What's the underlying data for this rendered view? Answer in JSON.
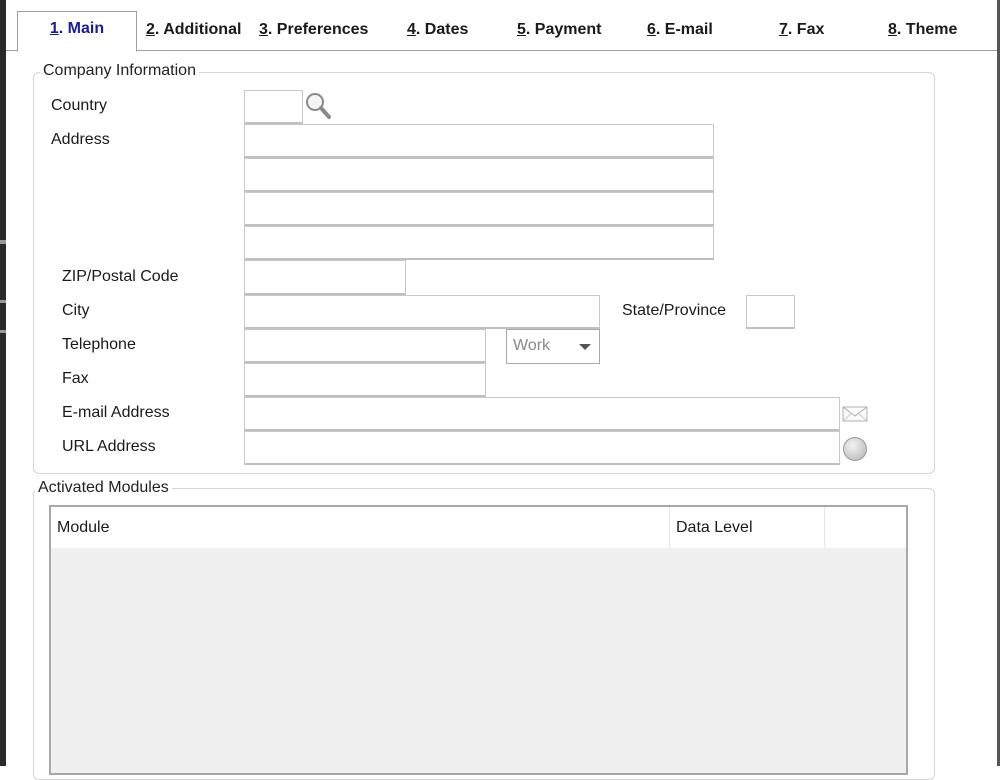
{
  "tabs": [
    {
      "num": "1",
      "label": ". Main",
      "active": true
    },
    {
      "num": "2",
      "label": ". Additional"
    },
    {
      "num": "3",
      "label": ". Preferences"
    },
    {
      "num": "4",
      "label": ". Dates"
    },
    {
      "num": "5",
      "label": ". Payment"
    },
    {
      "num": "6",
      "label": ". E-mail"
    },
    {
      "num": "7",
      "label": ". Fax"
    },
    {
      "num": "8",
      "label": ". Theme"
    }
  ],
  "company_info": {
    "title": "Company Information",
    "country_label": "Country",
    "country_value": "",
    "address_label": "Address",
    "address_lines": [
      "",
      "",
      "",
      ""
    ],
    "zip_label": "ZIP/Postal Code",
    "zip_value": "",
    "city_label": "City",
    "city_value": "",
    "state_label": "State/Province",
    "state_value": "",
    "telephone_label": "Telephone",
    "telephone_value": "",
    "telephone_type": "Work",
    "fax_label": "Fax",
    "fax_value": "",
    "email_label": "E-mail Address",
    "email_value": "",
    "url_label": "URL Address",
    "url_value": ""
  },
  "modules": {
    "title": "Activated Modules",
    "columns": [
      "Module",
      "Data Level",
      ""
    ],
    "rows": []
  }
}
